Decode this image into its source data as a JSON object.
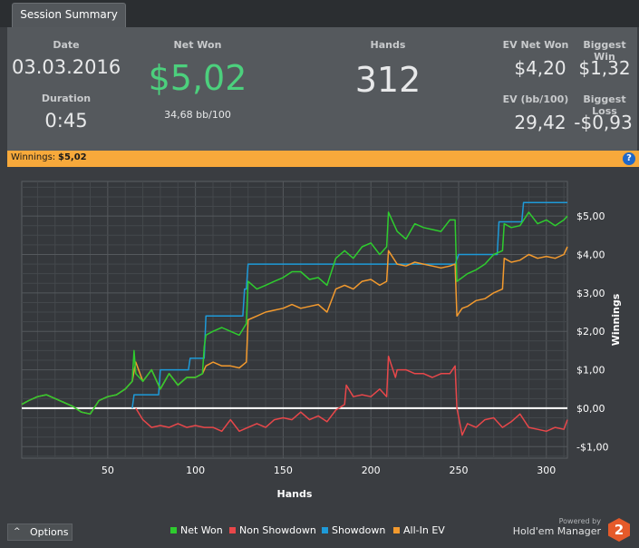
{
  "tab": {
    "label": "Session Summary"
  },
  "summary": {
    "date_label": "Date",
    "date_value": "03.03.2016",
    "duration_label": "Duration",
    "duration_value": "0:45",
    "net_won_label": "Net Won",
    "net_won_value": "$5,02",
    "bb100_value": "34,68 bb/100",
    "hands_label": "Hands",
    "hands_value": "312",
    "ev_net_won_label": "EV Net Won",
    "ev_net_won_value": "$4,20",
    "biggest_win_label": "Biggest Win",
    "biggest_win_value": "$1,32",
    "ev_bb100_label": "EV (bb/100)",
    "ev_bb100_value": "29,42",
    "biggest_loss_label": "Biggest Loss",
    "biggest_loss_value": "-$0,93"
  },
  "winnings_bar": {
    "label": "Winnings:",
    "value": "$5,02",
    "help_glyph": "?"
  },
  "options_button": {
    "label": "Options",
    "glyph": "^"
  },
  "branding": {
    "powered_by": "Powered by",
    "product": "Hold'em Manager",
    "logo_text": "2"
  },
  "colors": {
    "net_won": "#2ecc2e",
    "non_showdown": "#e8474a",
    "showdown": "#1e9ad8",
    "all_in_ev": "#f39a2e",
    "zero_line": "#ffffff",
    "net_won_value": "#4cd07d"
  },
  "chart_data": {
    "type": "line",
    "xlabel": "Hands",
    "ylabel": "Winnings",
    "xlim": [
      1,
      312
    ],
    "ylim": [
      -1.3,
      5.9
    ],
    "x_ticks": [
      50,
      100,
      150,
      200,
      250,
      300
    ],
    "y_ticks": [
      -1,
      0,
      1,
      2,
      3,
      4,
      5
    ],
    "y_tick_labels": [
      "-$1,00",
      "$0,00",
      "$1,00",
      "$2,00",
      "$3,00",
      "$4,00",
      "$5,00"
    ],
    "grid": true,
    "legend_position": "bottom",
    "series": [
      {
        "name": "Net Won",
        "color_key": "net_won",
        "x": [
          1,
          5,
          10,
          15,
          20,
          25,
          30,
          35,
          40,
          45,
          50,
          55,
          60,
          64,
          65,
          66,
          70,
          75,
          80,
          85,
          90,
          95,
          100,
          104,
          105,
          106,
          110,
          115,
          120,
          125,
          129,
          130,
          135,
          140,
          145,
          150,
          155,
          160,
          165,
          170,
          175,
          180,
          185,
          190,
          195,
          200,
          205,
          209,
          210,
          215,
          220,
          225,
          230,
          235,
          240,
          245,
          248,
          249,
          255,
          260,
          265,
          270,
          275,
          276,
          280,
          285,
          290,
          295,
          300,
          305,
          310,
          312
        ],
        "y": [
          0.1,
          0.2,
          0.3,
          0.35,
          0.25,
          0.15,
          0.05,
          -0.1,
          -0.15,
          0.2,
          0.3,
          0.35,
          0.5,
          0.7,
          1.5,
          0.9,
          0.7,
          1.0,
          0.5,
          0.9,
          0.6,
          0.8,
          0.8,
          0.9,
          1.6,
          1.9,
          2.0,
          2.1,
          2.0,
          1.9,
          2.2,
          3.3,
          3.1,
          3.2,
          3.3,
          3.4,
          3.55,
          3.55,
          3.35,
          3.4,
          3.2,
          3.9,
          4.1,
          3.9,
          4.2,
          4.3,
          4.0,
          4.2,
          5.1,
          4.6,
          4.4,
          4.8,
          4.7,
          4.65,
          4.6,
          4.9,
          4.9,
          3.3,
          3.5,
          3.6,
          3.75,
          4.0,
          4.1,
          4.8,
          4.7,
          4.75,
          5.1,
          4.8,
          4.9,
          4.75,
          4.9,
          5.0
        ]
      },
      {
        "name": "Non Showdown",
        "color_key": "non_showdown",
        "x": [
          66,
          70,
          75,
          80,
          85,
          90,
          95,
          100,
          105,
          110,
          115,
          120,
          125,
          130,
          135,
          140,
          145,
          150,
          155,
          160,
          165,
          170,
          175,
          180,
          185,
          186,
          190,
          195,
          200,
          205,
          209,
          210,
          214,
          215,
          220,
          225,
          230,
          235,
          240,
          245,
          248,
          249,
          252,
          255,
          260,
          265,
          270,
          275,
          280,
          285,
          290,
          295,
          300,
          305,
          310,
          312
        ],
        "y": [
          0.0,
          -0.3,
          -0.5,
          -0.45,
          -0.5,
          -0.4,
          -0.5,
          -0.45,
          -0.5,
          -0.5,
          -0.6,
          -0.3,
          -0.6,
          -0.5,
          -0.4,
          -0.5,
          -0.3,
          -0.25,
          -0.3,
          -0.1,
          -0.3,
          -0.2,
          -0.35,
          -0.05,
          0.1,
          0.6,
          0.3,
          0.35,
          0.3,
          0.5,
          0.3,
          1.35,
          0.8,
          1.0,
          1.0,
          0.9,
          0.9,
          0.8,
          0.9,
          0.9,
          1.1,
          0.0,
          -0.7,
          -0.4,
          -0.5,
          -0.3,
          -0.25,
          -0.5,
          -0.35,
          -0.15,
          -0.5,
          -0.55,
          -0.6,
          -0.5,
          -0.55,
          -0.3
        ]
      },
      {
        "name": "Showdown",
        "color_key": "showdown",
        "x": [
          64,
          65,
          79,
          80,
          96,
          97,
          105,
          106,
          127,
          128,
          129,
          130,
          163,
          164,
          247,
          248,
          250,
          272,
          273,
          286,
          287,
          296,
          312
        ],
        "y": [
          0.0,
          0.35,
          0.35,
          1.0,
          1.0,
          1.3,
          1.3,
          2.4,
          2.4,
          3.1,
          3.1,
          3.75,
          3.75,
          3.75,
          3.75,
          3.75,
          4.0,
          4.0,
          4.85,
          4.85,
          5.35,
          5.35,
          5.35
        ]
      },
      {
        "name": "All-In EV",
        "color_key": "all_in_ev",
        "x": [
          1,
          5,
          10,
          15,
          20,
          25,
          30,
          35,
          40,
          45,
          50,
          55,
          60,
          64,
          66,
          70,
          75,
          80,
          85,
          90,
          95,
          100,
          104,
          105,
          106,
          110,
          115,
          120,
          125,
          129,
          130,
          135,
          140,
          145,
          150,
          155,
          160,
          165,
          170,
          175,
          180,
          185,
          190,
          195,
          200,
          205,
          209,
          210,
          215,
          220,
          225,
          230,
          235,
          240,
          245,
          248,
          249,
          252,
          255,
          260,
          265,
          270,
          275,
          276,
          280,
          285,
          290,
          295,
          300,
          305,
          310,
          312
        ],
        "y": [
          0.1,
          0.2,
          0.3,
          0.35,
          0.25,
          0.15,
          0.05,
          -0.1,
          -0.15,
          0.2,
          0.3,
          0.35,
          0.5,
          0.7,
          1.2,
          0.7,
          1.0,
          0.5,
          0.9,
          0.6,
          0.8,
          0.8,
          0.9,
          1.0,
          1.1,
          1.2,
          1.1,
          1.1,
          1.05,
          1.2,
          2.3,
          2.4,
          2.5,
          2.55,
          2.6,
          2.7,
          2.6,
          2.65,
          2.7,
          2.5,
          3.1,
          3.2,
          3.1,
          3.3,
          3.35,
          3.2,
          3.3,
          4.1,
          3.75,
          3.7,
          3.8,
          3.75,
          3.7,
          3.65,
          3.7,
          3.75,
          2.4,
          2.6,
          2.65,
          2.8,
          2.85,
          3.0,
          3.1,
          3.9,
          3.8,
          3.85,
          4.0,
          3.9,
          3.95,
          3.9,
          4.0,
          4.2
        ]
      },
      {
        "name": "",
        "color_key": "zero_line",
        "x": [
          1,
          312
        ],
        "y": [
          0,
          0
        ]
      }
    ]
  }
}
